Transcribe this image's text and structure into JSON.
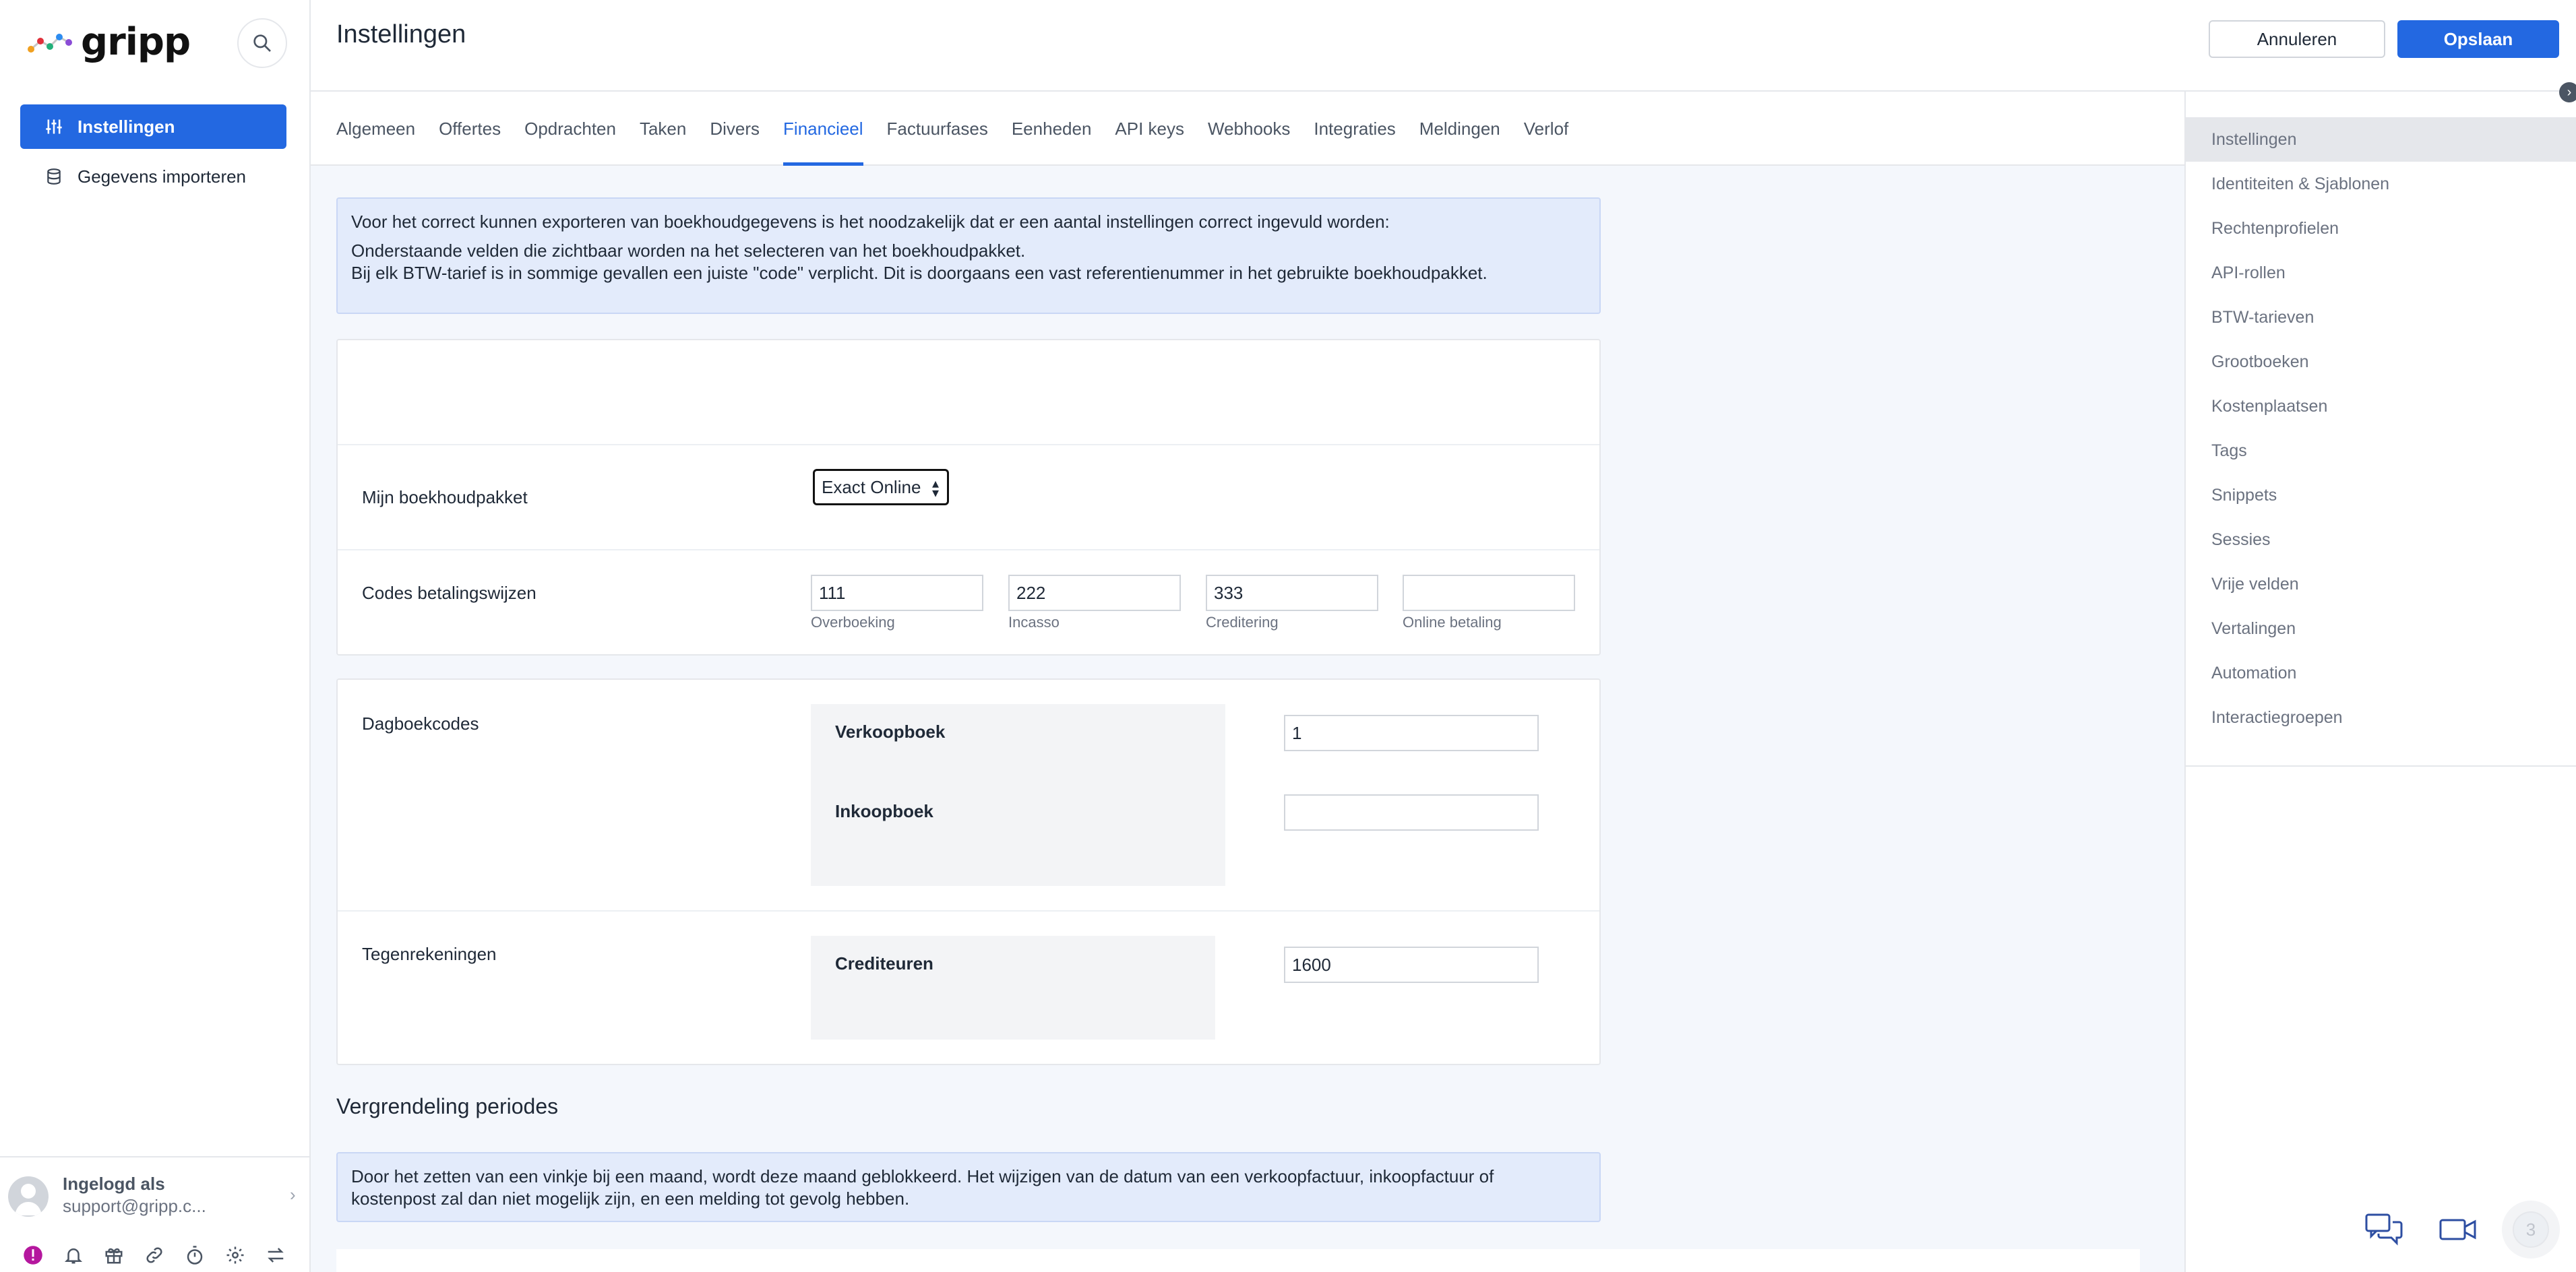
{
  "app": {
    "logo_text": "gripp"
  },
  "sidebar": {
    "items": [
      {
        "label": "Instellingen",
        "icon": "sliders-icon",
        "active": true
      },
      {
        "label": "Gegevens importeren",
        "icon": "database-icon",
        "active": false
      }
    ],
    "user": {
      "label": "Ingelogd als",
      "email": "support@gripp.c..."
    }
  },
  "header": {
    "title": "Instellingen",
    "cancel_label": "Annuleren",
    "save_label": "Opslaan"
  },
  "tabs": [
    "Algemeen",
    "Offertes",
    "Opdrachten",
    "Taken",
    "Divers",
    "Financieel",
    "Factuurfases",
    "Eenheden",
    "API keys",
    "Webhooks",
    "Integraties",
    "Meldingen",
    "Verlof"
  ],
  "active_tab": "Financieel",
  "info": {
    "line1": "Voor het correct kunnen exporteren van boekhoudgegevens is het noodzakelijk dat er een aantal instellingen correct ingevuld worden:",
    "line2": "Onderstaande velden die zichtbaar worden na het selecteren van het boekhoudpakket.",
    "line3": "Bij elk BTW-tarief is in sommige gevallen een juiste \"code\" verplicht. Dit is doorgaans een vast referentienummer in het gebruikte boekhoudpakket."
  },
  "accounting": {
    "package_label": "Mijn boekhoudpakket",
    "package_value": "Exact Online",
    "payment_codes_label": "Codes betalingswijzen",
    "payment_codes": [
      {
        "value": "111",
        "sub": "Overboeking"
      },
      {
        "value": "222",
        "sub": "Incasso"
      },
      {
        "value": "333",
        "sub": "Creditering"
      },
      {
        "value": "",
        "sub": "Online betaling"
      }
    ]
  },
  "journals": {
    "label": "Dagboekcodes",
    "sales_label": "Verkoopboek",
    "sales_value": "1",
    "purchase_label": "Inkoopboek",
    "purchase_value": "",
    "contra_label": "Tegenrekeningen",
    "creditors_label": "Crediteuren",
    "creditors_value": "1600"
  },
  "lock": {
    "title": "Vergrendeling periodes",
    "info_line1": "Door het zetten van een vinkje bij een maand, wordt deze maand geblokkeerd. Het wijzigen van de datum van een verkoopfactuur, inkoopfactuur of",
    "info_line2": "kostenpost zal dan niet mogelijk zijn, en een melding tot gevolg hebben."
  },
  "right_panel": {
    "items": [
      "Instellingen",
      "Identiteiten & Sjablonen",
      "Rechtenprofielen",
      "API-rollen",
      "BTW-tarieven",
      "Grootboeken",
      "Kostenplaatsen",
      "Tags",
      "Snippets",
      "Sessies",
      "Vrije velden",
      "Vertalingen",
      "Automation",
      "Interactiegroepen"
    ],
    "active": "Instellingen"
  },
  "colors": {
    "primary": "#2368e1",
    "info_bg": "#e3ebfb",
    "page_bg": "#f4f7fc"
  },
  "fab": {
    "badge": "3"
  }
}
